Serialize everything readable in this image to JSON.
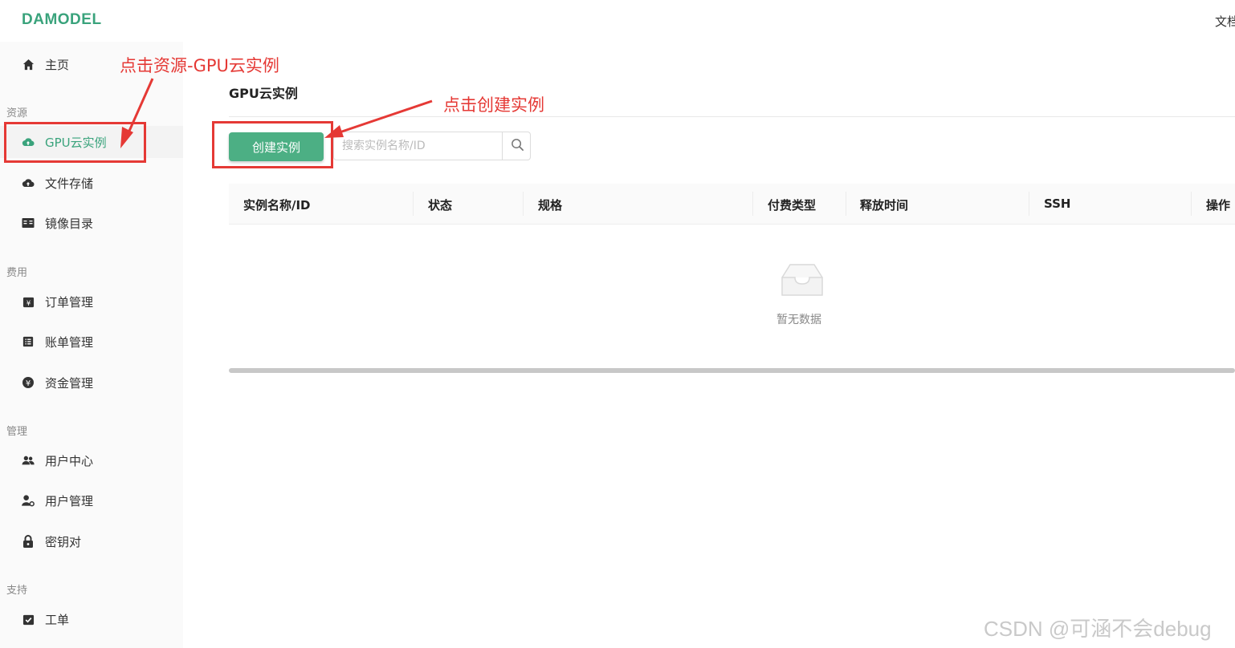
{
  "app": {
    "logo": "DAMODEL",
    "top_right": "文档"
  },
  "sidebar": {
    "home": "主页",
    "sections": [
      {
        "title": "资源",
        "items": [
          "GPU云实例",
          "文件存储",
          "镜像目录"
        ]
      },
      {
        "title": "费用",
        "items": [
          "订单管理",
          "账单管理",
          "资金管理"
        ]
      },
      {
        "title": "管理",
        "items": [
          "用户中心",
          "用户管理",
          "密钥对"
        ]
      },
      {
        "title": "支持",
        "items": [
          "工单"
        ]
      }
    ],
    "active_item": "GPU云实例"
  },
  "main": {
    "title": "GPU云实例",
    "create_button": "创建实例",
    "search_placeholder": "搜索实例名称/ID",
    "table": {
      "columns": [
        "实例名称/ID",
        "状态",
        "规格",
        "付费类型",
        "释放时间",
        "SSH",
        "操作"
      ],
      "rows": [],
      "empty_text": "暂无数据"
    }
  },
  "annotations": {
    "step1": "点击资源-GPU云实例",
    "step2": "点击创建实例",
    "color": "#e53935"
  },
  "watermark": "CSDN @可涵不会debug",
  "colors": {
    "accent": "#3aa37c",
    "button": "#4caf84"
  }
}
